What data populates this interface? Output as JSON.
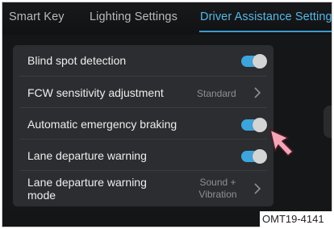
{
  "tabs": [
    {
      "label": "Smart Key"
    },
    {
      "label": "Lighting Settings"
    },
    {
      "label": "Driver Assistance Settings",
      "active": true
    }
  ],
  "settings": [
    {
      "label": "Blind spot detection",
      "control": "toggle",
      "state": "on"
    },
    {
      "label": "FCW sensitivity adjustment",
      "control": "select",
      "value": "Standard"
    },
    {
      "label": "Automatic emergency braking",
      "control": "toggle",
      "state": "on"
    },
    {
      "label": "Lane departure warning",
      "control": "toggle",
      "state": "on"
    },
    {
      "label_line1": "Lane departure warning",
      "label_line2": "mode",
      "control": "select",
      "value_line1": "Sound +",
      "value_line2": "Vibration"
    }
  ],
  "figure_code": "OMT19-4141",
  "colors": {
    "accent": "#3ea5dc",
    "active_tab": "#56b8e6",
    "panel": "#2b2d30",
    "background": "#151618",
    "cursor": "#f4a6b8"
  },
  "icons": [
    "chevron-right-icon",
    "pointer-cursor-icon"
  ]
}
